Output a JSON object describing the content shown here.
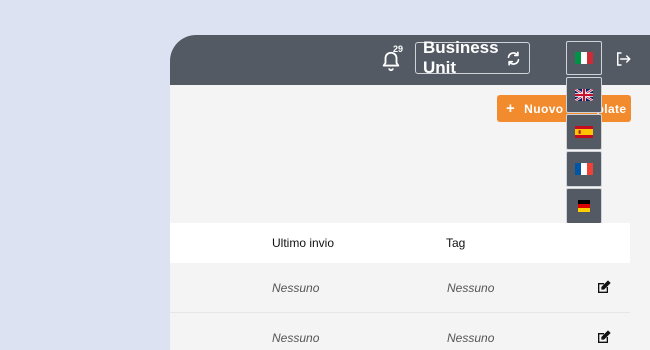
{
  "topbar": {
    "notifications_count": "29",
    "business_unit_label": "Business Unit",
    "current_language": "Italiano"
  },
  "toolbar": {
    "new_button_label": "Nuovo",
    "new_button_label_hidden_part": "Template"
  },
  "language_menu": [
    {
      "name": "English"
    },
    {
      "name": "Español"
    },
    {
      "name": "Français"
    },
    {
      "name": "Deutsch"
    }
  ],
  "table": {
    "columns": [
      "Ultimo invio",
      "Tag"
    ],
    "rows": [
      {
        "ultimo_invio": "Nessuno",
        "tag": "Nessuno"
      },
      {
        "ultimo_invio": "Nessuno",
        "tag": "Nessuno"
      }
    ]
  },
  "colors": {
    "topbar": "#545a64",
    "accent": "#f28a2e",
    "background": "#dde2f2"
  }
}
